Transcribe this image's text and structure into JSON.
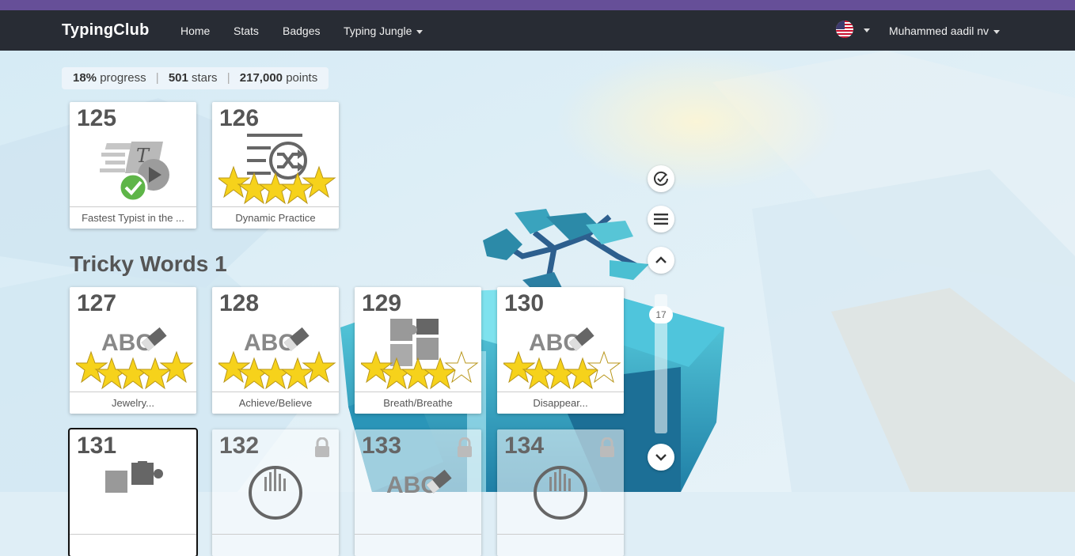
{
  "nav": {
    "brand": "TypingClub",
    "links": [
      "Home",
      "Stats",
      "Badges",
      "Typing Jungle"
    ],
    "user": "Muhammed aadil nv"
  },
  "stats": {
    "progress_value": "18%",
    "progress_label": "progress",
    "stars_value": "501",
    "stars_label": "stars",
    "points_value": "217,000",
    "points_label": "points"
  },
  "section_title": "Tricky Words 1",
  "lessons": [
    {
      "num": "125",
      "label": "Fastest Typist in the ...",
      "icon": "typing-video-icon",
      "status": "completed"
    },
    {
      "num": "126",
      "label": "Dynamic Practice",
      "icon": "shuffle-list-icon",
      "stars": 5
    },
    {
      "num": "127",
      "label": "Jewelry...",
      "icon": "abc-eraser-icon",
      "stars": 5
    },
    {
      "num": "128",
      "label": "Achieve/Believe",
      "icon": "abc-eraser-icon",
      "stars": 5
    },
    {
      "num": "129",
      "label": "Breath/Breathe",
      "icon": "puzzle-icon",
      "stars": 4
    },
    {
      "num": "130",
      "label": "Disappear...",
      "icon": "abc-eraser-icon",
      "stars": 4
    },
    {
      "num": "131",
      "label": "",
      "icon": "puzzle-icon"
    },
    {
      "num": "132",
      "label": "",
      "icon": "audio-icon",
      "locked": true
    },
    {
      "num": "133",
      "label": "",
      "icon": "abc-eraser-icon",
      "locked": true
    },
    {
      "num": "134",
      "label": "",
      "icon": "audio-icon",
      "locked": true
    }
  ],
  "scroll": {
    "level": "17"
  },
  "colors": {
    "topstrip": "#664f98",
    "navbar": "#282c34",
    "star": "#f6d21b"
  }
}
